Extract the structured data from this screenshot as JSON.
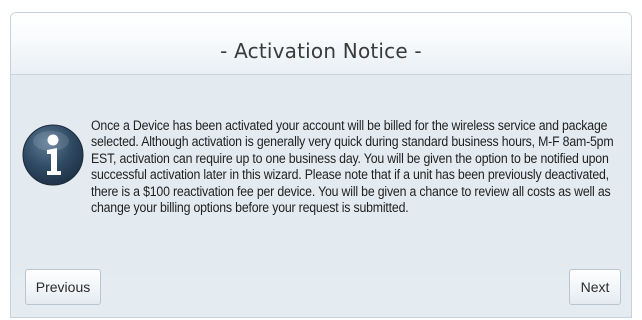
{
  "dialog": {
    "title": "- Activation Notice -",
    "icon": "info-icon",
    "message": "Once a Device has been activated your account will be billed for the wireless service and package selected. Although activation is generally very quick during standard business hours, M-F 8am-5pm EST, activation can require up to one business day. You will be given the option to be notified upon successful activation later in this wizard. Please note that if a unit has been previously deactivated, there is a $100 reactivation fee per device. You will be given a chance to review all costs as well as change your billing options before your request is submitted."
  },
  "buttons": {
    "previous_label": "Previous",
    "next_label": "Next"
  },
  "colors": {
    "panel_background": "#e3ebf1",
    "icon_fill": "#2f4a63",
    "text": "#1f1f1f"
  }
}
